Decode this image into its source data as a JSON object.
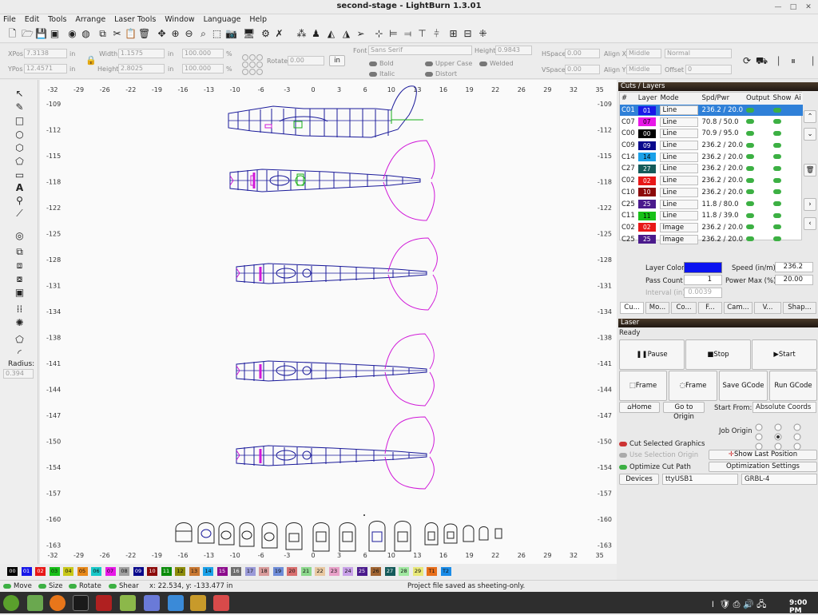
{
  "window": {
    "title": "second-stage - LightBurn 1.3.01"
  },
  "menu": [
    "File",
    "Edit",
    "Tools",
    "Arrange",
    "Laser Tools",
    "Window",
    "Language",
    "Help"
  ],
  "props": {
    "xpos_label": "XPos",
    "xpos": "7.3138",
    "ypos_label": "YPos",
    "ypos": "12.4571",
    "unit": "in",
    "width_label": "Width",
    "width": "1.1575",
    "height_label": "Height",
    "height": "2.8025",
    "pct1": "100.000",
    "pct2": "100.000",
    "pct": "%",
    "rotate_label": "Rotate",
    "rotate": "0.00",
    "in_btn": "in",
    "font_label": "Font",
    "font": "Sans Serif",
    "fheight_label": "Height",
    "fheight": "0.9843",
    "hspace_label": "HSpace",
    "hspace": "0.00",
    "vspace_label": "VSpace",
    "vspace": "0.00",
    "alignx_label": "Align X",
    "alignx": "Middle",
    "aligny_label": "Align Y",
    "aligny": "Middle",
    "normal": "Normal",
    "offset_label": "Offset",
    "offset": "0",
    "bold": "Bold",
    "italic": "Italic",
    "upper": "Upper Case",
    "distort": "Distort",
    "welded": "Welded"
  },
  "ruler": {
    "top": [
      "-32",
      "-29",
      "-26",
      "-22",
      "-19",
      "-16",
      "-13",
      "-10",
      "-6",
      "-3",
      "0",
      "3",
      "6",
      "10",
      "13",
      "16",
      "19",
      "22",
      "26",
      "29",
      "32",
      "35"
    ],
    "left": [
      "-109",
      "-112",
      "-115",
      "-118",
      "-122",
      "-125",
      "-128",
      "-131",
      "-134",
      "-138",
      "-141",
      "-144",
      "-147",
      "-150",
      "-154",
      "-157",
      "-160",
      "-163"
    ]
  },
  "radius": {
    "label": "Radius:",
    "value": "0.394"
  },
  "cuts": {
    "header": "Cuts / Layers",
    "columns": [
      "#",
      "Layer",
      "Mode",
      "Spd/Pwr",
      "Output",
      "Show",
      "Ai"
    ],
    "rows": [
      {
        "id": "C01",
        "layer": "01",
        "color": "#1818e8",
        "mode": "Line",
        "sp": "236.2 / 20.0"
      },
      {
        "id": "C07",
        "layer": "07",
        "color": "#e818e8",
        "mode": "Line",
        "sp": "70.8 / 50.0"
      },
      {
        "id": "C00",
        "layer": "00",
        "color": "#000000",
        "mode": "Line",
        "sp": "70.9 / 95.0"
      },
      {
        "id": "C09",
        "layer": "09",
        "color": "#0a0a8c",
        "mode": "Line",
        "sp": "236.2 / 20.0"
      },
      {
        "id": "C14",
        "layer": "14",
        "color": "#1aa0e8",
        "mode": "Line",
        "sp": "236.2 / 20.0"
      },
      {
        "id": "C27",
        "layer": "27",
        "color": "#145a5a",
        "mode": "Line",
        "sp": "236.2 / 20.0"
      },
      {
        "id": "C02",
        "layer": "02",
        "color": "#e81818",
        "mode": "Line",
        "sp": "236.2 / 20.0"
      },
      {
        "id": "C10",
        "layer": "10",
        "color": "#8c0a0a",
        "mode": "Line",
        "sp": "236.2 / 20.0"
      },
      {
        "id": "C25",
        "layer": "25",
        "color": "#4a1a8c",
        "mode": "Line",
        "sp": "11.8 / 80.0"
      },
      {
        "id": "C11",
        "layer": "11",
        "color": "#18c018",
        "mode": "Line",
        "sp": "11.8 / 39.0"
      },
      {
        "id": "C02",
        "layer": "02",
        "color": "#e81818",
        "mode": "Image",
        "sp": "236.2 / 20.0"
      },
      {
        "id": "C25",
        "layer": "25",
        "color": "#4a1a8c",
        "mode": "Image",
        "sp": "236.2 / 20.0"
      }
    ]
  },
  "layer_props": {
    "color_label": "Layer Color",
    "color": "#0a12f0",
    "speed_label": "Speed (in/m)",
    "speed": "236.2",
    "pass_label": "Pass Count",
    "pass": "1",
    "power_label": "Power Max (%)",
    "power": "20.00",
    "interval_label": "Interval (in)",
    "interval": "0.0039"
  },
  "tabs": [
    "Cu...",
    "Mo...",
    "Co...",
    "F...",
    "Cam...",
    "V...",
    "Shap..."
  ],
  "laser": {
    "header": "Laser",
    "status": "Ready",
    "pause": "Pause",
    "stop": "Stop",
    "start": "Start",
    "frame1": "Frame",
    "frame2": "Frame",
    "save_gcode": "Save GCode",
    "run_gcode": "Run GCode",
    "home": "Home",
    "go_origin": "Go to Origin",
    "start_from_label": "Start From:",
    "start_from": "Absolute Coords",
    "job_origin": "Job Origin",
    "cut_selected": "Cut Selected Graphics",
    "use_sel_origin": "Use Selection Origin",
    "show_last": "Show Last Position",
    "optimize": "Optimize Cut Path",
    "opt_settings": "Optimization Settings",
    "devices": "Devices",
    "port": "ttyUSB1",
    "device": "GRBL-4"
  },
  "palette": [
    {
      "l": "00",
      "c": "#000000"
    },
    {
      "l": "01",
      "c": "#1818e8"
    },
    {
      "l": "02",
      "c": "#e81818"
    },
    {
      "l": "03",
      "c": "#18c018"
    },
    {
      "l": "04",
      "c": "#c8c818"
    },
    {
      "l": "05",
      "c": "#e88818"
    },
    {
      "l": "06",
      "c": "#18c8c8"
    },
    {
      "l": "07",
      "c": "#e818e8"
    },
    {
      "l": "08",
      "c": "#a0a0a0"
    },
    {
      "l": "09",
      "c": "#0a0a8c"
    },
    {
      "l": "10",
      "c": "#8c0a0a"
    },
    {
      "l": "11",
      "c": "#0a8c0a"
    },
    {
      "l": "12",
      "c": "#8c8c0a"
    },
    {
      "l": "13",
      "c": "#c87832"
    },
    {
      "l": "14",
      "c": "#1aa0e8"
    },
    {
      "l": "15",
      "c": "#8c0a8c"
    },
    {
      "l": "16",
      "c": "#6e6e6e"
    },
    {
      "l": "17",
      "c": "#9a9ad8"
    },
    {
      "l": "18",
      "c": "#d89a9a"
    },
    {
      "l": "19",
      "c": "#6e8cd8"
    },
    {
      "l": "20",
      "c": "#d86e6e"
    },
    {
      "l": "21",
      "c": "#8cd88c"
    },
    {
      "l": "22",
      "c": "#e8c8a0"
    },
    {
      "l": "23",
      "c": "#e8a0c8"
    },
    {
      "l": "24",
      "c": "#c8a0e8"
    },
    {
      "l": "25",
      "c": "#4a1a8c"
    },
    {
      "l": "26",
      "c": "#a06432"
    },
    {
      "l": "27",
      "c": "#145a5a"
    },
    {
      "l": "28",
      "c": "#a0e8a0"
    },
    {
      "l": "29",
      "c": "#e8e878"
    },
    {
      "l": "T1",
      "c": "#e86e1a"
    },
    {
      "l": "T2",
      "c": "#1a8ce8"
    }
  ],
  "status": {
    "move": "Move",
    "size": "Size",
    "rotate": "Rotate",
    "shear": "Shear",
    "coords": "x: 22.534, y: -133.477 in",
    "message": "Project file saved as sheeting-only."
  },
  "clock": "9:00 PM",
  "colors": {
    "accent": "#2f80d8",
    "line": "#1a1a9a",
    "magenta": "#d018d8",
    "green": "#18b018"
  }
}
